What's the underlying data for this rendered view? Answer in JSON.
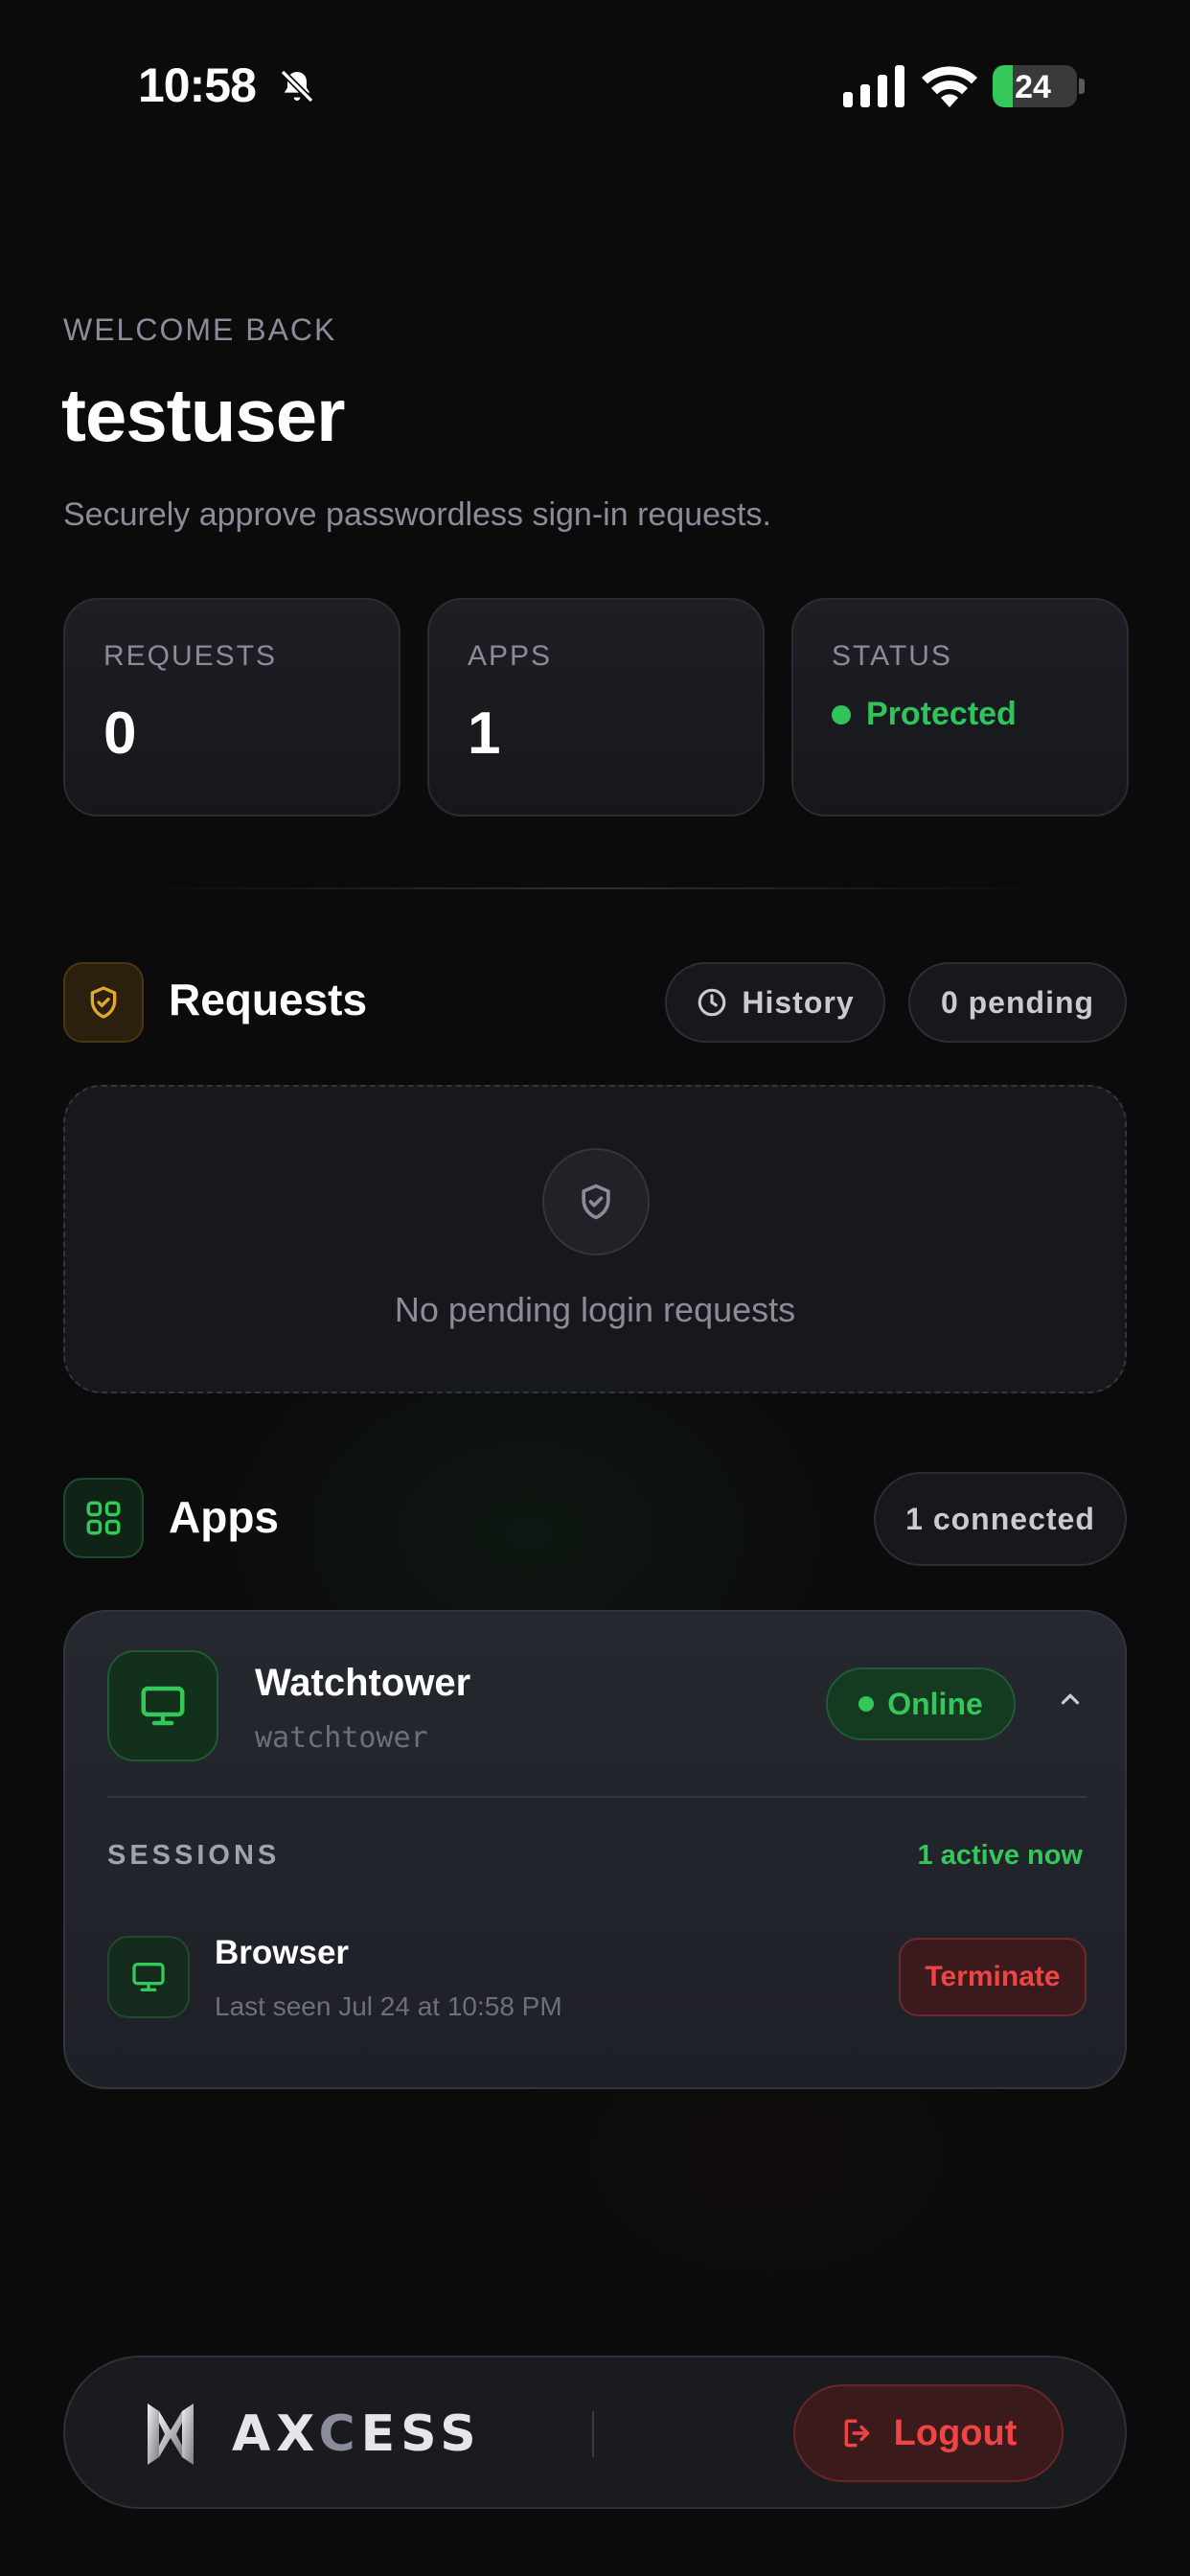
{
  "status_bar": {
    "time": "10:58",
    "battery": "24",
    "battery_fraction": 0.24,
    "icons": [
      "bell-slash-icon",
      "cellular-signal-icon",
      "wifi-icon",
      "battery-icon"
    ]
  },
  "header": {
    "greeting": "WELCOME BACK",
    "username": "testuser",
    "subtitle": "Securely approve passwordless sign-in requests."
  },
  "stats": {
    "requests": {
      "label": "REQUESTS",
      "value": "0"
    },
    "apps": {
      "label": "APPS",
      "value": "1"
    },
    "status": {
      "label": "STATUS",
      "value": "Protected"
    }
  },
  "requests_section": {
    "title": "Requests",
    "history_label": "History",
    "pending_label": "0 pending",
    "empty_text": "No pending login requests"
  },
  "apps_section": {
    "title": "Apps",
    "connected_label": "1 connected",
    "app": {
      "name": "Watchtower",
      "slug": "watchtower",
      "status": "Online",
      "sessions_label": "SESSIONS",
      "active_label": "1 active now",
      "session": {
        "name": "Browser",
        "last_seen": "Last seen Jul 24 at 10:58 PM",
        "terminate_label": "Terminate"
      }
    }
  },
  "bottom_bar": {
    "logo_text_a": "AX",
    "logo_text_b": "C",
    "logo_text_c": "ESS",
    "logout_label": "Logout"
  },
  "colors": {
    "background": "#0b0b0c",
    "accent_green": "#30c45a",
    "danger_red": "#ef4444",
    "warning_yellow": "#e0a82e"
  }
}
